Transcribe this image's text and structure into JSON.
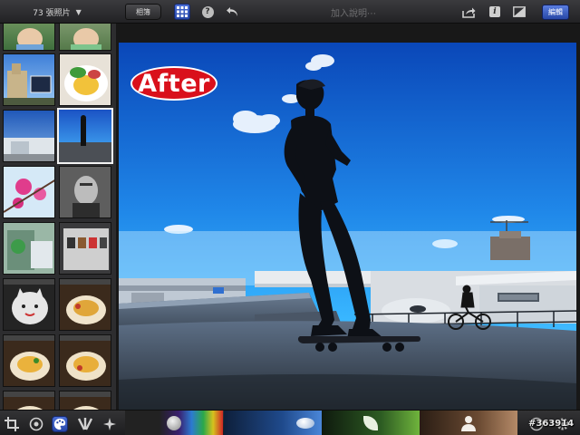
{
  "topbar": {
    "photo_count": "73 張照片",
    "albums_label": "相簿",
    "caption_placeholder": "加入說明⋯",
    "edit_label": "編輯"
  },
  "icons": {
    "photo_count": "chevron-down-icon",
    "grid": "grid-icon",
    "help": "help-icon",
    "undo": "undo-icon",
    "share": "share-icon",
    "info": "info-icon",
    "compare": "compare-icon",
    "crop": "crop-icon",
    "color": "color-wheel-icon",
    "palette": "palette-icon",
    "brushes": "brushes-icon",
    "effects": "effects-icon",
    "settings": "gear-icon"
  },
  "help_glyph": "?",
  "info_glyph": "i",
  "photo": {
    "badge": "After"
  },
  "watermark": "#363914",
  "colors": {
    "accent": "#3a5ed0",
    "badge": "#d9101b",
    "sky_top": "#0a47b8",
    "sky_bottom": "#38b6ff"
  }
}
